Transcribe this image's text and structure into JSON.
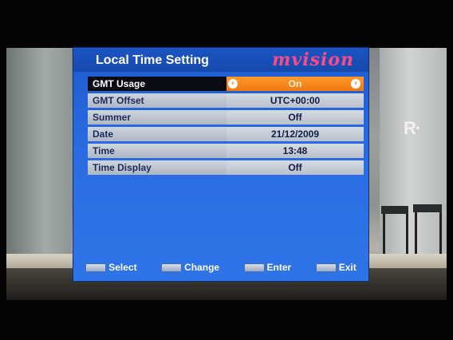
{
  "menu": {
    "title": "Local Time Setting",
    "brand": "mvision",
    "rows": [
      {
        "label": "GMT Usage",
        "value": "On",
        "selected": true
      },
      {
        "label": "GMT Offset",
        "value": "UTC+00:00"
      },
      {
        "label": "Summer",
        "value": "Off"
      },
      {
        "label": "Date",
        "value": "21/12/2009"
      },
      {
        "label": "Time",
        "value": "13:48"
      },
      {
        "label": "Time Display",
        "value": "Off"
      }
    ],
    "arrows": {
      "left": "‹",
      "right": "›"
    }
  },
  "footer": {
    "select": "Select",
    "change": "Change",
    "enter": "Enter",
    "exit": "Exit"
  },
  "channel_logo": "R·",
  "colors": {
    "menu_blue": "#2a6ce0",
    "selected_orange": "#f07812",
    "brand_pink": "#ff4a8a"
  }
}
